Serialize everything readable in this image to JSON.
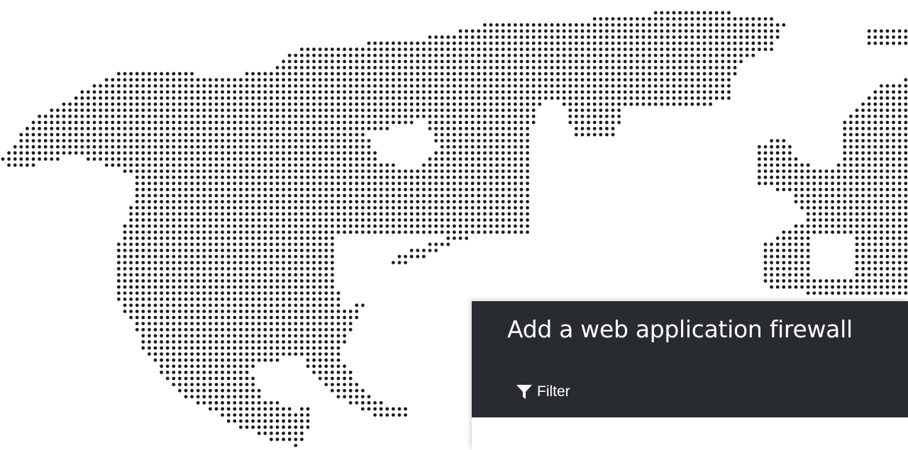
{
  "panel": {
    "title": "Add a web application firewall",
    "filter_label": "Filter"
  },
  "map": {
    "description_icon": "world-dot-map",
    "dot_color": "#1a1a1a",
    "background_color": "#ffffff"
  },
  "colors": {
    "panel_header": "#282c30",
    "panel_text": "#ffffff"
  },
  "icons": {
    "filter": "funnel-icon"
  }
}
